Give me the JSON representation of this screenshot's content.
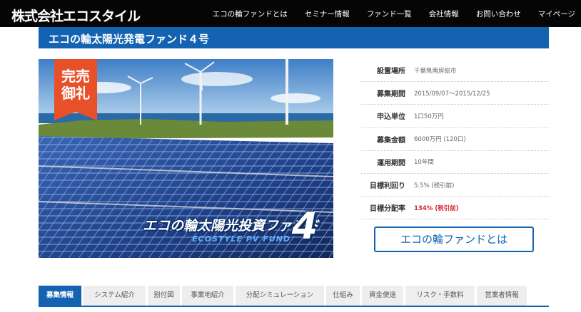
{
  "header": {
    "logo": "株式会社エコスタイル",
    "nav": [
      "エコの輪ファンドとは",
      "セミナー情報",
      "ファンド一覧",
      "会社情報",
      "お問い合わせ",
      "マイページ"
    ]
  },
  "fund": {
    "title": "エコの輪太陽光発電ファンド４号",
    "badge": "完売御礼",
    "hero_title": "エコの輪太陽光投資ファンド",
    "hero_subtitle": "ECOSTYLE PV FUND",
    "hero_number": "4"
  },
  "info": [
    {
      "label": "設置場所",
      "value": "千葉県南房総市"
    },
    {
      "label": "募集期間",
      "value": "2015/09/07～2015/12/25"
    },
    {
      "label": "申込単位",
      "value": "1口50万円"
    },
    {
      "label": "募集金額",
      "value": "6000万円 (120口)"
    },
    {
      "label": "運用期間",
      "value": "10年間"
    },
    {
      "label": "目標利回り",
      "value": "5.5% (税引前)"
    },
    {
      "label": "目標分配率",
      "value": "134% (税引前)"
    }
  ],
  "about_button": "エコの輪ファンドとは",
  "tabs": [
    "募集情報",
    "システム紹介",
    "割付図",
    "事業地紹介",
    "分配シミュレーション",
    "仕組み",
    "資金使途",
    "リスク・手数料",
    "営業者情報"
  ],
  "colors": {
    "brand_blue": "#1463b2",
    "header_black": "#050505",
    "badge_orange": "#e8502a",
    "highlight_red": "#d4232b"
  }
}
